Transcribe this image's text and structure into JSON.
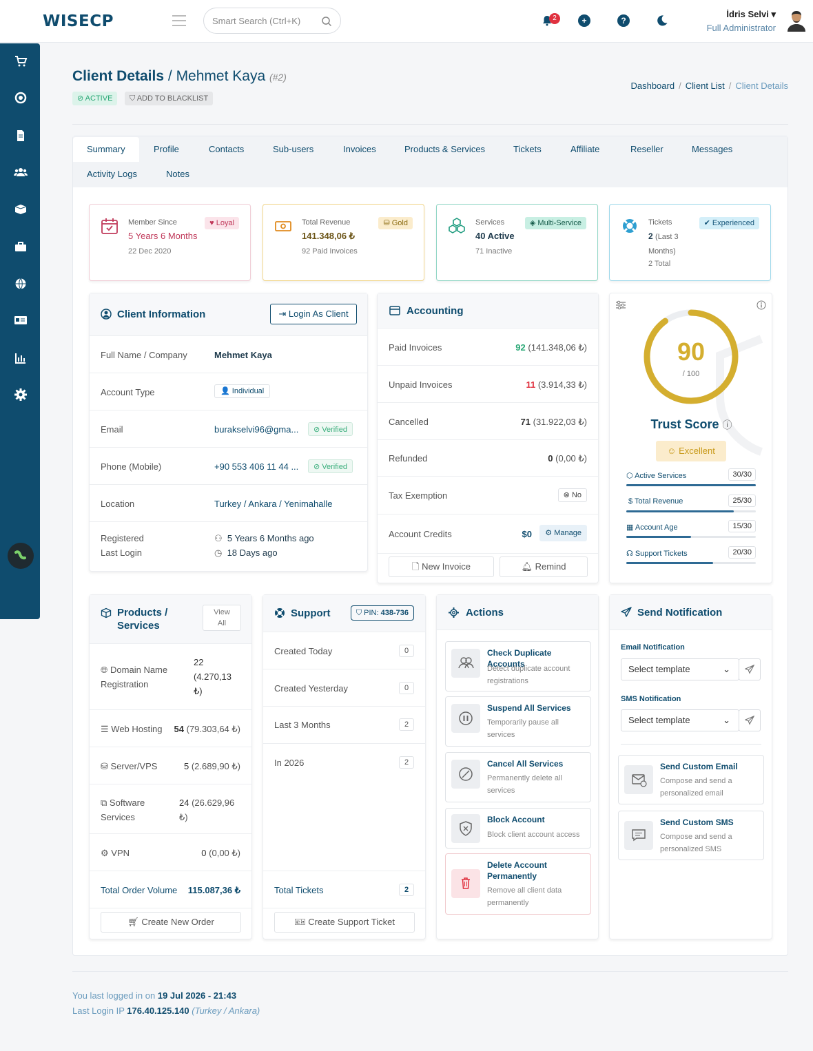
{
  "header": {
    "logo": "WISECP",
    "search_placeholder": "Smart Search (Ctrl+K)",
    "notification_count": "2",
    "user_name": "İdris Selvi",
    "user_role": "Full Administrator"
  },
  "sidebar": {
    "icons": [
      "cart-icon",
      "support-icon",
      "document-icon",
      "users-icon",
      "box-icon",
      "toolbox-icon",
      "globe-icon",
      "id-card-icon",
      "chart-icon",
      "settings-icon"
    ]
  },
  "page": {
    "title_bold": "Client Details",
    "title_sep": " / ",
    "client_name": "Mehmet Kaya",
    "client_id": "(#2)",
    "status": "ACTIVE",
    "blacklist": "ADD TO BLACKLIST",
    "breadcrumb": [
      "Dashboard",
      "Client List",
      "Client Details"
    ]
  },
  "tabs": [
    "Summary",
    "Profile",
    "Contacts",
    "Sub-users",
    "Invoices",
    "Products & Services",
    "Tickets",
    "Affiliate",
    "Reseller",
    "Messages",
    "Activity Logs",
    "Notes"
  ],
  "stats": [
    {
      "label": "Member Since",
      "value": "5 Years 6 Months",
      "sub": "22 Dec 2020",
      "tag": "Loyal"
    },
    {
      "label": "Total Revenue",
      "value": "141.348,06 ₺",
      "sub": "92 Paid Invoices",
      "tag": "Gold"
    },
    {
      "label": "Services",
      "value": "40 Active",
      "sub": "71 Inactive",
      "tag": "Multi-Service"
    },
    {
      "label": "Tickets",
      "value": "2",
      "value_suffix": "(Last 3",
      "value_suffix2": "Months)",
      "sub": "2 Total",
      "tag": "Experienced"
    }
  ],
  "client_info": {
    "title": "Client Information",
    "login_button": "Login As Client",
    "rows": {
      "name_k": "Full Name / Company",
      "name_v": "Mehmet Kaya",
      "type_k": "Account Type",
      "type_v": "Individual",
      "email_k": "Email",
      "email_v": "burakselvi96@gma...",
      "email_badge": "Verified",
      "phone_k": "Phone (Mobile)",
      "phone_v": "+90 553 406 11 44 ...",
      "phone_badge": "Verified",
      "loc_k": "Location",
      "loc_v": "Turkey / Ankara / Yenimahalle",
      "reg_k": "Registered",
      "reg_v": "5 Years 6 Months ago",
      "last_k": "Last Login",
      "last_v": "18 Days ago"
    }
  },
  "accounting": {
    "title": "Accounting",
    "paid_k": "Paid Invoices",
    "paid_n": "92",
    "paid_v": "(141.348,06 ₺)",
    "unpaid_k": "Unpaid Invoices",
    "unpaid_n": "11",
    "unpaid_v": "(3.914,33 ₺)",
    "cancel_k": "Cancelled",
    "cancel_n": "71",
    "cancel_v": "(31.922,03 ₺)",
    "refund_k": "Refunded",
    "refund_n": "0",
    "refund_v": "(0,00 ₺)",
    "tax_k": "Tax Exemption",
    "tax_v": "No",
    "credit_k": "Account Credits",
    "credit_v": "$0",
    "manage": "Manage",
    "new_invoice": "New Invoice",
    "remind": "Remind"
  },
  "trust": {
    "score": "90",
    "max": "/ 100",
    "score_value": 90,
    "title": "Trust Score",
    "rating": "Excellent",
    "items": [
      {
        "label": "Active Services",
        "value": "30/30",
        "pct": 100
      },
      {
        "label": "Total Revenue",
        "value": "25/30",
        "pct": 83
      },
      {
        "label": "Account Age",
        "value": "15/30",
        "pct": 50
      },
      {
        "label": "Support Tickets",
        "value": "20/30",
        "pct": 67
      }
    ]
  },
  "products": {
    "title1": "Products /",
    "title2": "Services",
    "view1": "View",
    "view2": "All",
    "domain_k1": "Domain Name",
    "domain_k2": "Registration",
    "domain_v1": "22",
    "domain_v2": "(4.270,13",
    "domain_v3": "₺)",
    "hosting_k": "Web Hosting",
    "hosting_n": "54",
    "hosting_v": "(79.303,64 ₺)",
    "server_k": "Server/VPS",
    "server_n": "5",
    "server_v": "(2.689,90 ₺)",
    "soft_k1": "Software",
    "soft_k2": "Services",
    "soft_n": "24",
    "soft_v1": "(26.629,96",
    "soft_v2": "₺)",
    "vpn_k": "VPN",
    "vpn_n": "0",
    "vpn_v": "(0,00 ₺)",
    "total_k": "Total Order Volume",
    "total_v": "115.087,36 ₺",
    "create": "Create New Order"
  },
  "support": {
    "title": "Support",
    "pin_label": "PIN:",
    "pin": "438-736",
    "rows": [
      {
        "label": "Created Today",
        "count": "0"
      },
      {
        "label": "Created Yesterday",
        "count": "0"
      },
      {
        "label": "Last 3 Months",
        "count": "2"
      },
      {
        "label": "In 2026",
        "count": "2"
      }
    ],
    "total_k": "Total Tickets",
    "total_v": "2",
    "create": "Create Support Ticket"
  },
  "actions": {
    "title": "Actions",
    "items": [
      {
        "title": "Check Duplicate Accounts",
        "desc": "Detect duplicate account registrations"
      },
      {
        "title": "Suspend All Services",
        "desc": "Temporarily pause all services"
      },
      {
        "title": "Cancel All Services",
        "desc": "Permanently delete all services"
      },
      {
        "title": "Block Account",
        "desc": "Block client account access"
      },
      {
        "title": "Delete Account Permanently",
        "desc": "Remove all client data permanently"
      }
    ]
  },
  "notify": {
    "title": "Send Notification",
    "email_label": "Email Notification",
    "email_select": "Select template",
    "sms_label": "SMS Notification",
    "sms_select": "Select template",
    "custom_email": "Send Custom Email",
    "custom_email_desc": "Compose and send a personalized email",
    "custom_sms": "Send Custom SMS",
    "custom_sms_desc": "Compose and send a personalized SMS"
  },
  "footer": {
    "last_prefix": "You last logged in on",
    "last_date": "19 Jul 2026 - 21:43",
    "ip_prefix": "Last Login IP",
    "ip": "176.40.125.140",
    "ip_loc": "(Turkey / Ankara)"
  },
  "colors": {
    "brand": "#0f4c6e",
    "gold": "#d4ae2f",
    "success": "#2aa876",
    "danger": "#e0313f"
  }
}
